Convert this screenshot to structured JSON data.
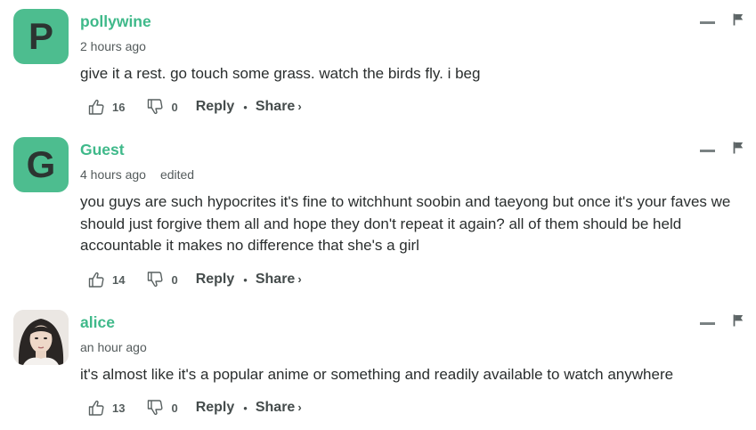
{
  "comments": [
    {
      "author": "pollywine",
      "avatar_letter": "P",
      "avatar_color": "#4dbd8f",
      "time": "2 hours ago",
      "edited": "",
      "text": "give it a rest. go touch some grass. watch the birds fly. i beg",
      "upvotes": "16",
      "downvotes": "0",
      "reply_label": "Reply",
      "share_label": "Share",
      "share_chevron": "›"
    },
    {
      "author": "Guest",
      "avatar_letter": "G",
      "avatar_color": "#4dbd8f",
      "time": "4 hours ago",
      "edited": "edited",
      "text": "you guys are such hypocrites it's fine to witchhunt soobin and taeyong but once it's your faves we should just forgive them all and hope they don't repeat it again? all of them should be held accountable it makes no difference that she's a girl",
      "upvotes": "14",
      "downvotes": "0",
      "reply_label": "Reply",
      "share_label": "Share",
      "share_chevron": "›"
    },
    {
      "author": "alice",
      "avatar_letter": "",
      "avatar_color": "#e8e4e0",
      "time": "an hour ago",
      "edited": "",
      "text": "it's almost like it's a popular anime or something and readily available to watch anywhere",
      "upvotes": "13",
      "downvotes": "0",
      "reply_label": "Reply",
      "share_label": "Share",
      "share_chevron": "›"
    }
  ],
  "separator": "•",
  "icons": {
    "upvote": "thumbs-up-icon",
    "downvote": "thumbs-down-icon",
    "minimize": "minimize-icon",
    "flag": "flag-icon"
  },
  "colors": {
    "author": "#3fb98a",
    "avatar": "#4dbd8f",
    "text": "#2a2e2e",
    "muted": "#545b5c"
  }
}
